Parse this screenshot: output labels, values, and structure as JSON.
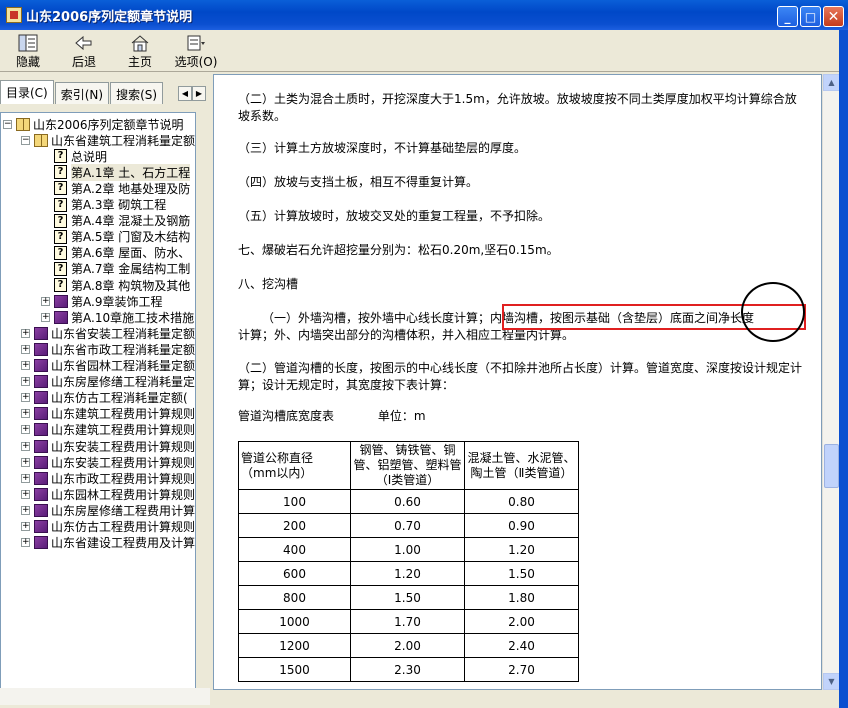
{
  "window": {
    "title": "山东2006序列定额章节说明",
    "minimize_label": "_",
    "maximize_label": "□",
    "close_label": "✕"
  },
  "toolbar": {
    "items": [
      {
        "label": "隐藏",
        "icon": "hide-pane-icon"
      },
      {
        "label": "后退",
        "icon": "back-arrow-icon"
      },
      {
        "label": "主页",
        "icon": "home-icon"
      },
      {
        "label": "选项(O)",
        "icon": "options-icon"
      }
    ]
  },
  "left_tabs": [
    {
      "label": "目录(C)",
      "active": true
    },
    {
      "label": "索引(N)",
      "active": false
    },
    {
      "label": "搜索(S)",
      "active": false
    }
  ],
  "tree": [
    {
      "label": "山东2006序列定额章节说明",
      "level": 0,
      "type": "book-open",
      "expander": "−"
    },
    {
      "label": "山东省建筑工程消耗量定额",
      "level": 1,
      "type": "book-open",
      "expander": "−"
    },
    {
      "label": "总说明",
      "level": 2,
      "type": "doc",
      "expander": ""
    },
    {
      "label": "第A.1章  土、石方工程",
      "level": 2,
      "type": "doc",
      "expander": "",
      "selected": true
    },
    {
      "label": "第A.2章  地基处理及防",
      "level": 2,
      "type": "doc",
      "expander": ""
    },
    {
      "label": "第A.3章  砌筑工程",
      "level": 2,
      "type": "doc",
      "expander": ""
    },
    {
      "label": "第A.4章  混凝土及钢筋",
      "level": 2,
      "type": "doc",
      "expander": ""
    },
    {
      "label": "第A.5章  门窗及木结构",
      "level": 2,
      "type": "doc",
      "expander": ""
    },
    {
      "label": "第A.6章  屋面、防水、",
      "level": 2,
      "type": "doc",
      "expander": ""
    },
    {
      "label": "第A.7章  金属结构工制",
      "level": 2,
      "type": "doc",
      "expander": ""
    },
    {
      "label": "第A.8章  构筑物及其他",
      "level": 2,
      "type": "doc",
      "expander": ""
    },
    {
      "label": "第A.9章装饰工程",
      "level": 2,
      "type": "book-closed",
      "expander": "+"
    },
    {
      "label": "第A.10章施工技术措施",
      "level": 2,
      "type": "book-closed",
      "expander": "+"
    },
    {
      "label": "山东省安装工程消耗量定额",
      "level": 1,
      "type": "book-closed",
      "expander": "+"
    },
    {
      "label": "山东省市政工程消耗量定额",
      "level": 1,
      "type": "book-closed",
      "expander": "+"
    },
    {
      "label": "山东省园林工程消耗量定额",
      "level": 1,
      "type": "book-closed",
      "expander": "+"
    },
    {
      "label": "山东房屋修缮工程消耗量定",
      "level": 1,
      "type": "book-closed",
      "expander": "+"
    },
    {
      "label": "山东仿古工程消耗量定额(",
      "level": 1,
      "type": "book-closed",
      "expander": "+"
    },
    {
      "label": "山东建筑工程费用计算规则",
      "level": 1,
      "type": "book-closed",
      "expander": "+"
    },
    {
      "label": "山东建筑工程费用计算规则",
      "level": 1,
      "type": "book-closed",
      "expander": "+"
    },
    {
      "label": "山东安装工程费用计算规则",
      "level": 1,
      "type": "book-closed",
      "expander": "+"
    },
    {
      "label": "山东安装工程费用计算规则",
      "level": 1,
      "type": "book-closed",
      "expander": "+"
    },
    {
      "label": "山东市政工程费用计算规则",
      "level": 1,
      "type": "book-closed",
      "expander": "+"
    },
    {
      "label": "山东园林工程费用计算规则",
      "level": 1,
      "type": "book-closed",
      "expander": "+"
    },
    {
      "label": "山东房屋修缮工程费用计算",
      "level": 1,
      "type": "book-closed",
      "expander": "+"
    },
    {
      "label": "山东仿古工程费用计算规则",
      "level": 1,
      "type": "book-closed",
      "expander": "+"
    },
    {
      "label": "山东省建设工程费用及计算",
      "level": 1,
      "type": "book-closed",
      "expander": "+"
    }
  ],
  "content": {
    "p1": "（二）土类为混合土质时，开挖深度大于1.5m，允许放坡。放坡坡度按不同土类厚度加权平均计算综合放坡系数。",
    "p2": "（三）计算土方放坡深度时，不计算基础垫层的厚度。",
    "p3": "（四）放坡与支挡土板，相互不得重复计算。",
    "p4": "（五）计算放坡时，放坡交叉处的重复工程量，不予扣除。",
    "p5": "七、爆破岩石允许超挖量分别为：松石0.20m,坚石0.15m。",
    "p6": "八、挖沟槽",
    "p7a": "（一）外墙沟槽，按外墙中心线长度计算；",
    "p7b": "内墙沟槽，按图示基础（含垫层）底面之间净长度",
    "p7c": "计算；外、内墙突出部分的沟槽体积，并入相应工程量内计算。",
    "p8": "（二）管道沟槽的长度，按图示的中心线长度（不扣除井池所占长度）计算。管道宽度、深度按设计规定计算；设计无规定时，其宽度按下表计算：",
    "table_title": "管道沟槽底宽度表",
    "table_unit": "单位：m",
    "table": {
      "headers": [
        "管道公称直径（mm以内）",
        "钢管、铸铁管、铜管、铝塑管、塑料管（Ⅰ类管道）",
        "混凝土管、水泥管、陶土管（Ⅱ类管道）"
      ],
      "rows": [
        [
          "100",
          "0.60",
          "0.80"
        ],
        [
          "200",
          "0.70",
          "0.90"
        ],
        [
          "400",
          "1.00",
          "1.20"
        ],
        [
          "600",
          "1.20",
          "1.50"
        ],
        [
          "800",
          "1.50",
          "1.80"
        ],
        [
          "1000",
          "1.70",
          "2.00"
        ],
        [
          "1200",
          "2.00",
          "2.40"
        ],
        [
          "1500",
          "2.30",
          "2.70"
        ]
      ]
    }
  },
  "scrollbar": {
    "up": "▲",
    "down": "▼"
  }
}
